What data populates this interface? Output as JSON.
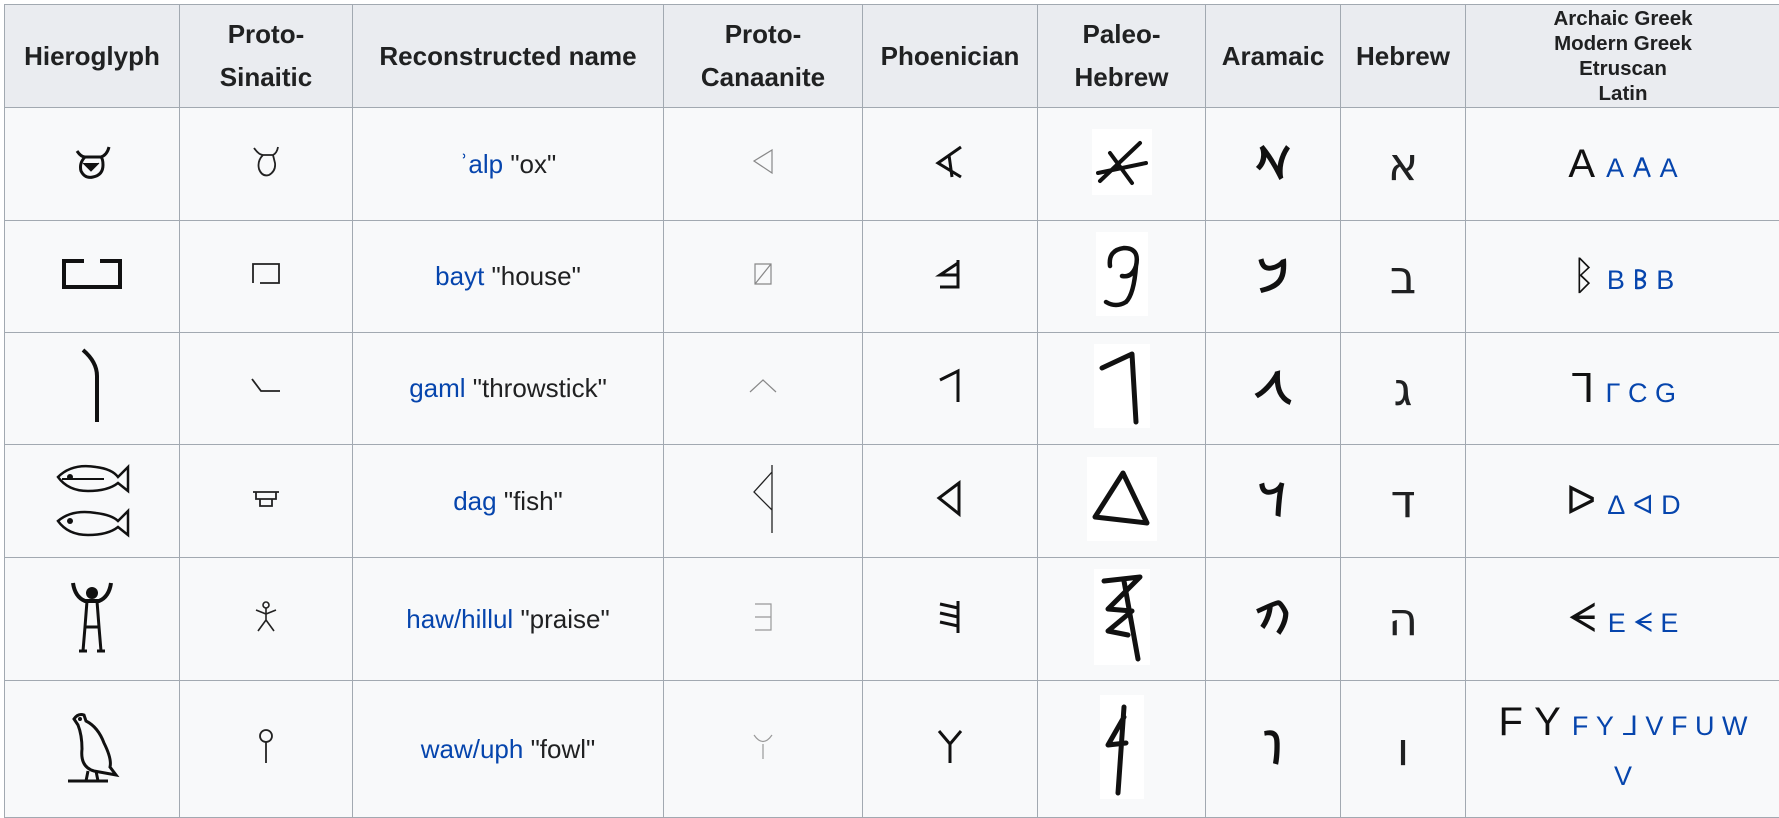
{
  "headers": {
    "hieroglyph": "Hieroglyph",
    "proto_sinaitic": "Proto-Sinaitic",
    "reconstructed_name": "Reconstructed name",
    "proto_canaanite": "Proto-Canaanite",
    "phoenician": "Phoenician",
    "paleo_hebrew": "Paleo-Hebrew",
    "aramaic": "Aramaic",
    "hebrew": "Hebrew",
    "archaic_greek": "Archaic Greek",
    "modern_greek": "Modern Greek",
    "etruscan": "Etruscan",
    "latin": "Latin"
  },
  "header_lines": {
    "proto_sinaitic": [
      "Proto-",
      "Sinaitic"
    ],
    "proto_canaanite": [
      "Proto-",
      "Canaanite"
    ],
    "paleo_hebrew": [
      "Paleo-",
      "Hebrew"
    ]
  },
  "rows": [
    {
      "name_link": "ʾalp",
      "name_gloss": " \"ox\"",
      "phoenician_icon": "phoenician-aleph-icon",
      "aramaic": "𐡀",
      "hebrew": "א",
      "archaic_greek": "A",
      "modern_greek": "A",
      "etruscan": "𐌀",
      "latin": "A"
    },
    {
      "name_link": "bayt",
      "name_gloss": " \"house\"",
      "phoenician_icon": "phoenician-beth-icon",
      "aramaic": "𐡁",
      "hebrew": "ב",
      "archaic_greek": "ᛒ",
      "modern_greek": "B",
      "etruscan": "𐌁",
      "latin": "B"
    },
    {
      "name_link": "gaml",
      "name_gloss": " \"throwstick\"",
      "phoenician_icon": "phoenician-gimel-icon",
      "aramaic": "𐡂",
      "hebrew": "ג",
      "archaic_greek": "ᒣ",
      "modern_greek": "Γ",
      "etruscan": "C",
      "latin": "G"
    },
    {
      "name_link": "dag",
      "name_gloss": " \"fish\"",
      "phoenician_icon": "phoenician-daleth-icon",
      "aramaic": "𐡃",
      "hebrew": "ד",
      "archaic_greek": "ᐅ",
      "modern_greek": "Δ",
      "etruscan": "ᐊ",
      "latin": "D"
    },
    {
      "name_link": "haw/hillul",
      "name_gloss": " \"praise\"",
      "phoenician_icon": "phoenician-he-icon",
      "aramaic": "𐡄",
      "hebrew": "ה",
      "archaic_greek": "ᗕ",
      "modern_greek": "E",
      "etruscan": "ᗕ",
      "latin": "E"
    },
    {
      "name_link": "waw/uph",
      "name_gloss": " \"fowl\"",
      "phoenician_icon": "phoenician-waw-icon",
      "aramaic": "𐡅",
      "hebrew": "ו",
      "archaic_greek": "F",
      "archaic_greek_2": "Y",
      "modern_greek": "F",
      "modern_greek_2": "Y",
      "etruscan": "ᒧ",
      "etruscan_2": "V",
      "latin": "F",
      "latin_2": "U",
      "latin_3": "W",
      "latin_4": "V"
    }
  ],
  "colors": {
    "link": "#0645ad",
    "header_bg": "#eaecf0",
    "cell_bg": "#f8f9fa",
    "border": "#a2a9b1"
  }
}
